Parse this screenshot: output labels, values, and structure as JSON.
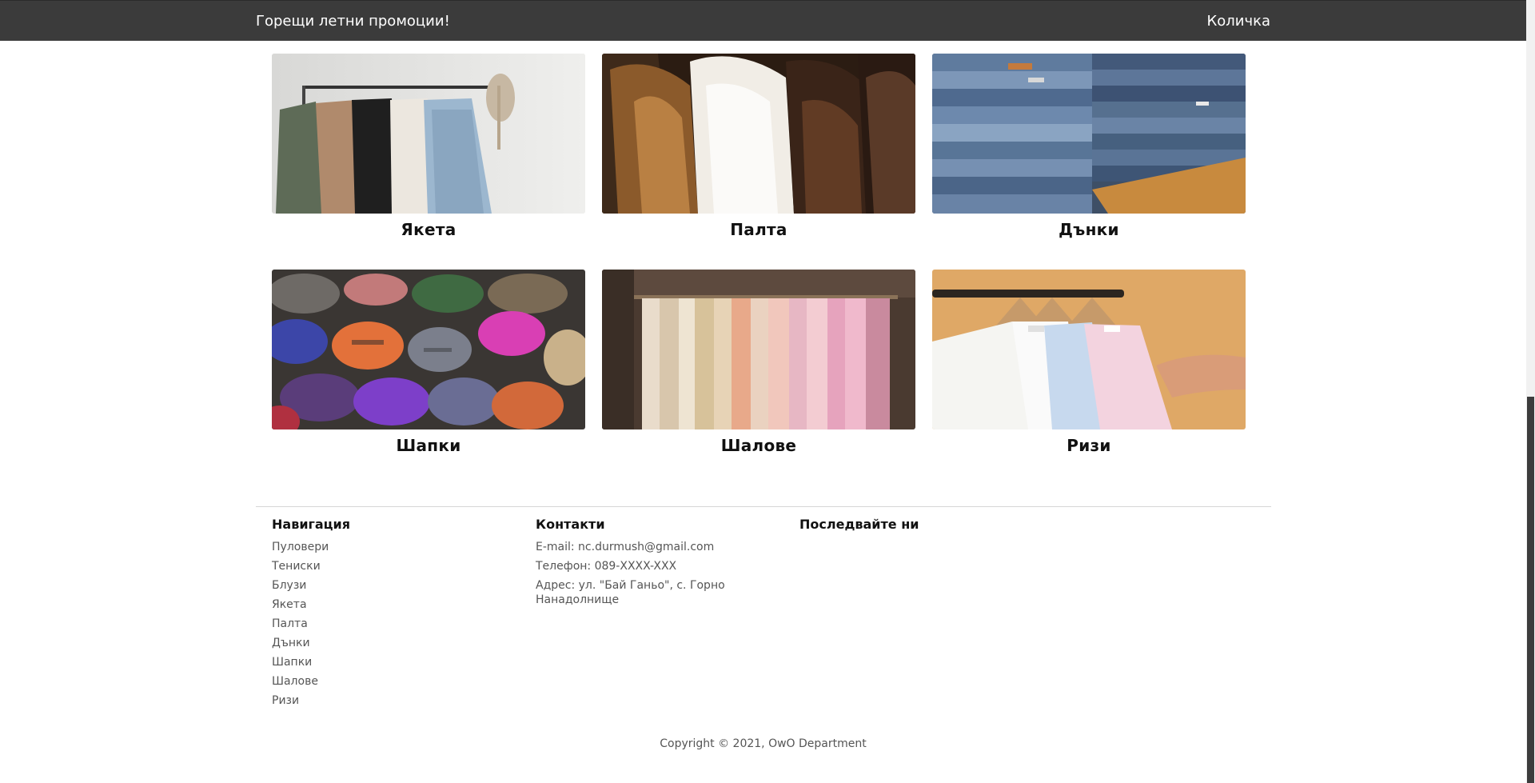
{
  "header": {
    "promo_link": "Горещи летни промоции!",
    "cart_link": "Количка"
  },
  "categories": [
    {
      "label": "Якета",
      "image": "jackets-rack-photo"
    },
    {
      "label": "Палта",
      "image": "fur-coats-photo"
    },
    {
      "label": "Дънки",
      "image": "stacked-jeans-photo"
    },
    {
      "label": "Шапки",
      "image": "colorful-hats-photo"
    },
    {
      "label": "Шалове",
      "image": "scarves-rack-photo"
    },
    {
      "label": "Ризи",
      "image": "hanging-shirts-photo"
    }
  ],
  "footer": {
    "navigation": {
      "title": "Навигация",
      "items": [
        "Пуловери",
        "Тениски",
        "Блузи",
        "Якета",
        "Палта",
        "Дънки",
        "Шапки",
        "Шалове",
        "Ризи"
      ]
    },
    "contacts": {
      "title": "Контакти",
      "email": "E-mail: nc.durmush@gmail.com",
      "phone": "Телефон: 089-XXXX-XXX",
      "address": "Адрес: ул. \"Бай Ганьо\", с. Горно Нанадолнище"
    },
    "follow": {
      "title": "Последвайте ни"
    },
    "copyright": "Copyright © 2021, OwO Department"
  },
  "colors": {
    "topbar": "#3b3b3b",
    "topbar_text": "#ffffff",
    "scroll_thumb": "#3c3c3c"
  }
}
